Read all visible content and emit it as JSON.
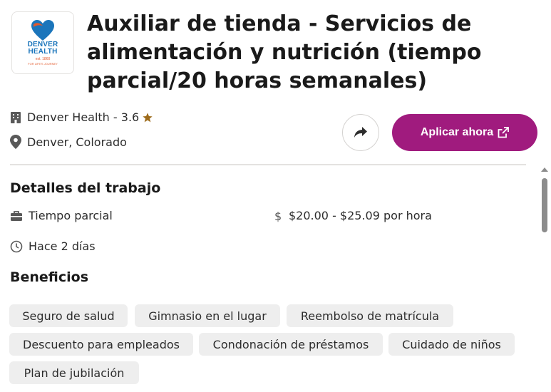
{
  "job": {
    "title": "Auxiliar de tienda - Servicios de alimentación y nutrición (tiempo parcial/20 horas semanales)",
    "company": "Denver Health - 3.6",
    "location": "Denver, Colorado",
    "rating_stars": 1
  },
  "logo": {
    "line1": "DENVER",
    "line2": "HEALTH",
    "est": "est. 1860",
    "tagline": "FOR LIFE'S JOURNEY"
  },
  "actions": {
    "apply_label": "Aplicar ahora",
    "share_icon": "share-icon"
  },
  "details": {
    "heading": "Detalles del trabajo",
    "job_type": "Tiempo parcial",
    "pay": "$20.00 - $25.09 por hora",
    "posted": "Hace 2 días"
  },
  "benefits": {
    "heading": "Beneficios",
    "items": [
      "Seguro de salud",
      "Gimnasio en el lugar",
      "Reembolso de matrícula",
      "Descuento para empleados",
      "Condonación de préstamos",
      "Cuidado de niños",
      "Plan de jubilación"
    ]
  },
  "colors": {
    "apply_button": "#a01b7e",
    "star": "#9d6b1b",
    "logo_blue": "#1b75bb",
    "logo_orange": "#e2592c"
  }
}
